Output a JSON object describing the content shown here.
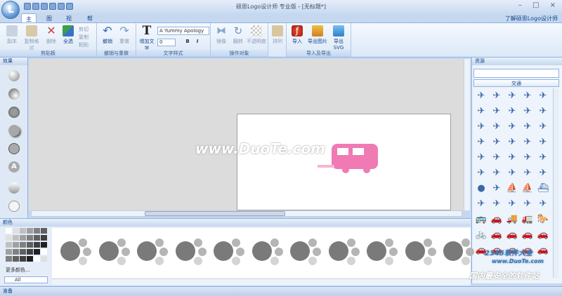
{
  "title": "硕思Logo设计师 专业版 - [无标题*]",
  "tabs": [
    "主页",
    "图层",
    "视图",
    "帮助"
  ],
  "help_link": "了解硕思Logo设计师",
  "ribbon": {
    "clipboard": {
      "label": "剪贴板",
      "copy": "副本",
      "copy_format": "复制格式",
      "delete": "删除",
      "select_all": "全选",
      "cut": "剪切",
      "dup": "复制",
      "paste": "粘贴"
    },
    "undo": {
      "label": "撤销与重做",
      "undo": "撤销",
      "redo": "重做"
    },
    "text": {
      "label": "文字样式",
      "add_text": "增加文字",
      "font": "A Yummy Apology",
      "size": "0",
      "bold": "B",
      "italic": "I"
    },
    "object": {
      "label": "操作对象",
      "mirror": "镜像",
      "rotate": "翻转",
      "opacity": "不透明度",
      "arrange": "排列"
    },
    "export": {
      "label": "导入及导出",
      "import": "导入",
      "export_image": "导出图片",
      "export_svg": "导出SVG"
    }
  },
  "panels": {
    "effects": "效果",
    "resources": "资源",
    "colors": "颜色",
    "category": "交通",
    "more_colors": "更多颜色...",
    "filter": "All"
  },
  "watermark": {
    "main": "www.DuoTe.com",
    "brand": "2345软件大全",
    "brand_url": "www.DuoTe.com",
    "slogan": "国内最安全的软件站"
  },
  "status": "准备",
  "colors": {
    "accent": "#15428b",
    "ribbon_border": "#8db2e3",
    "logo_pink": "#f07ab4"
  }
}
